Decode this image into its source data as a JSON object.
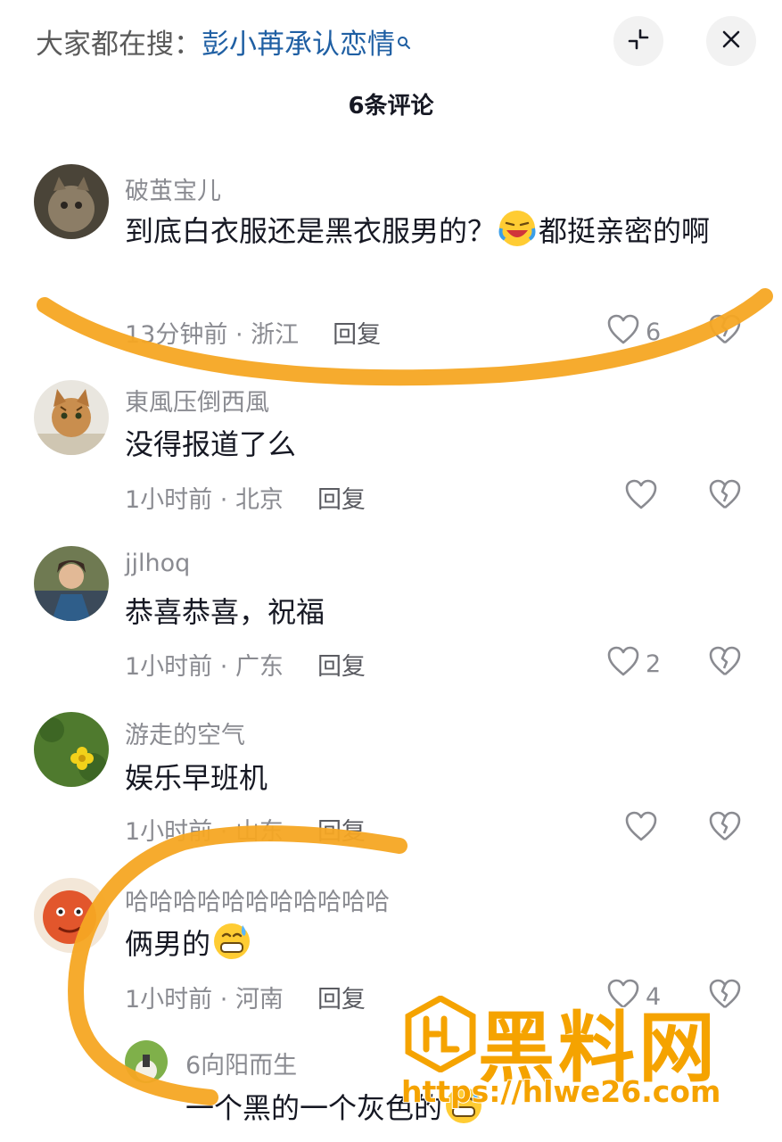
{
  "header": {
    "search_prefix": "大家都在搜：",
    "search_keyword": "彭小苒承认恋情",
    "title": "6条评论"
  },
  "comments": [
    {
      "username": "破茧宝儿",
      "content_a": "到底白衣服还是黑衣服男的？",
      "content_b": "都挺亲密的啊",
      "time": "13分钟前",
      "location": "浙江",
      "reply": "回复",
      "likes": "6"
    },
    {
      "username": "東風压倒西風",
      "content": "没得报道了么",
      "time": "1小时前",
      "location": "北京",
      "reply": "回复",
      "likes": ""
    },
    {
      "username": "jjlhoq",
      "content": "恭喜恭喜，祝福",
      "time": "1小时前",
      "location": "广东",
      "reply": "回复",
      "likes": "2"
    },
    {
      "username": "游走的空气",
      "content": "娱乐早班机",
      "time": "1小时前",
      "location": "山东",
      "reply": "回复",
      "likes": ""
    },
    {
      "username": "哈哈哈哈哈哈哈哈哈哈哈",
      "content": "俩男的",
      "time": "1小时前",
      "location": "河南",
      "reply": "回复",
      "likes": "4"
    }
  ],
  "sub_reply": {
    "username": "6向阳而生",
    "content": "一个黑的一个灰色的"
  },
  "watermark": {
    "name": "黑料网",
    "url": "https://hlwe26.com"
  },
  "colors": {
    "accent_keyword": "#1f5fa3",
    "annotation": "#f5a623",
    "watermark": "#f5a300",
    "secondary_text": "#8a8b91"
  }
}
